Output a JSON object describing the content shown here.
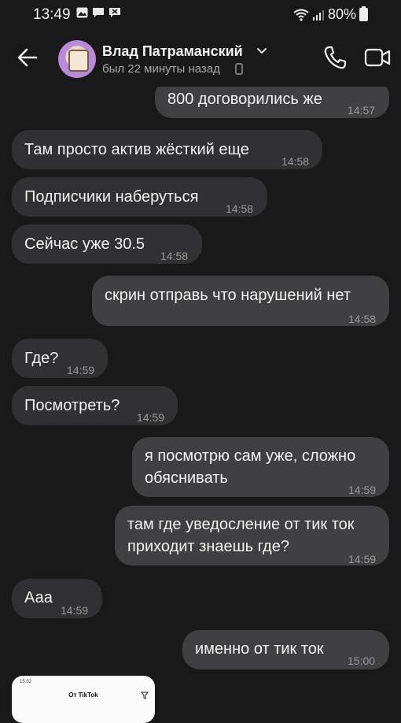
{
  "status_bar": {
    "time": "13:49",
    "battery": "80%",
    "notification_icons": [
      "gallery-icon",
      "message-icon",
      "missed-call-icon"
    ]
  },
  "header": {
    "contact_name": "Влад Патраманский",
    "contact_status": "был 22 минуты назад"
  },
  "messages": [
    {
      "direction": "out",
      "text": "800 договорились же",
      "time": "14:57"
    },
    {
      "direction": "in",
      "text": "Там просто актив жёсткий еще",
      "time": "14:58"
    },
    {
      "direction": "in",
      "text": "Подписчики наберуться",
      "time": "14:58"
    },
    {
      "direction": "in",
      "text": "Сейчас уже 30.5",
      "time": "14:58"
    },
    {
      "direction": "out",
      "text": "скрин отправь что нарушений нет",
      "time": "14:58"
    },
    {
      "direction": "in",
      "text": "Где?",
      "time": "14:59"
    },
    {
      "direction": "in",
      "text": "Посмотреть?",
      "time": "14:59"
    },
    {
      "direction": "out",
      "lines": [
        "я посмотрю сам уже, сложно",
        "обяснивать"
      ],
      "time": "14:59"
    },
    {
      "direction": "out",
      "lines": [
        "там где уведосление от тик ток",
        "приходит знаешь где?"
      ],
      "time": "14:59"
    },
    {
      "direction": "in",
      "text": "Ааа",
      "time": "14:59"
    },
    {
      "direction": "out",
      "text": "именно от тик ток",
      "time": "15:00"
    }
  ],
  "preview": {
    "status_time": "15:02",
    "title": "От TikTok"
  }
}
